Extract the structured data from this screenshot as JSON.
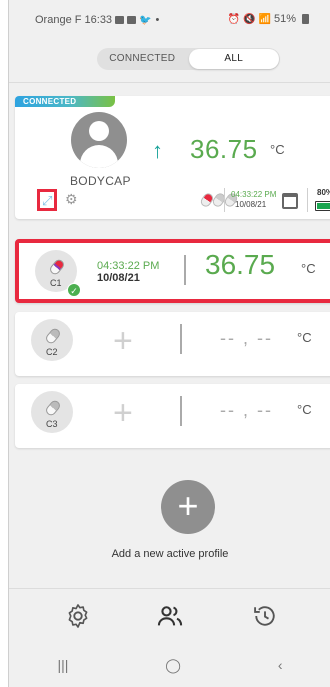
{
  "status_bar": {
    "carrier_time": "Orange F 16:33",
    "battery": "51%"
  },
  "tabs": {
    "connected": "CONNECTED",
    "all": "ALL",
    "active": "all"
  },
  "device": {
    "badge": "CONNECTED",
    "name": "BODYCAP",
    "temperature": "36.75",
    "unit": "°C",
    "trend": "up",
    "last_time": "04:33:22 PM",
    "last_date": "10/08/21",
    "battery_label": "80%",
    "battery_level": 0.8
  },
  "capsules": [
    {
      "label": "C1",
      "time": "04:33:22 PM",
      "date": "10/08/21",
      "temperature": "36.75",
      "unit": "°C",
      "connected": true
    },
    {
      "label": "C2",
      "placeholder": "-- , --",
      "unit": "°C",
      "connected": false
    },
    {
      "label": "C3",
      "placeholder": "-- , --",
      "unit": "°C",
      "connected": false
    }
  ],
  "add_profile": {
    "text": "Add a new active profile"
  },
  "colors": {
    "accent_green": "#5aaa4f",
    "arrow": "#1aa39a",
    "highlight": "#e8293f"
  }
}
